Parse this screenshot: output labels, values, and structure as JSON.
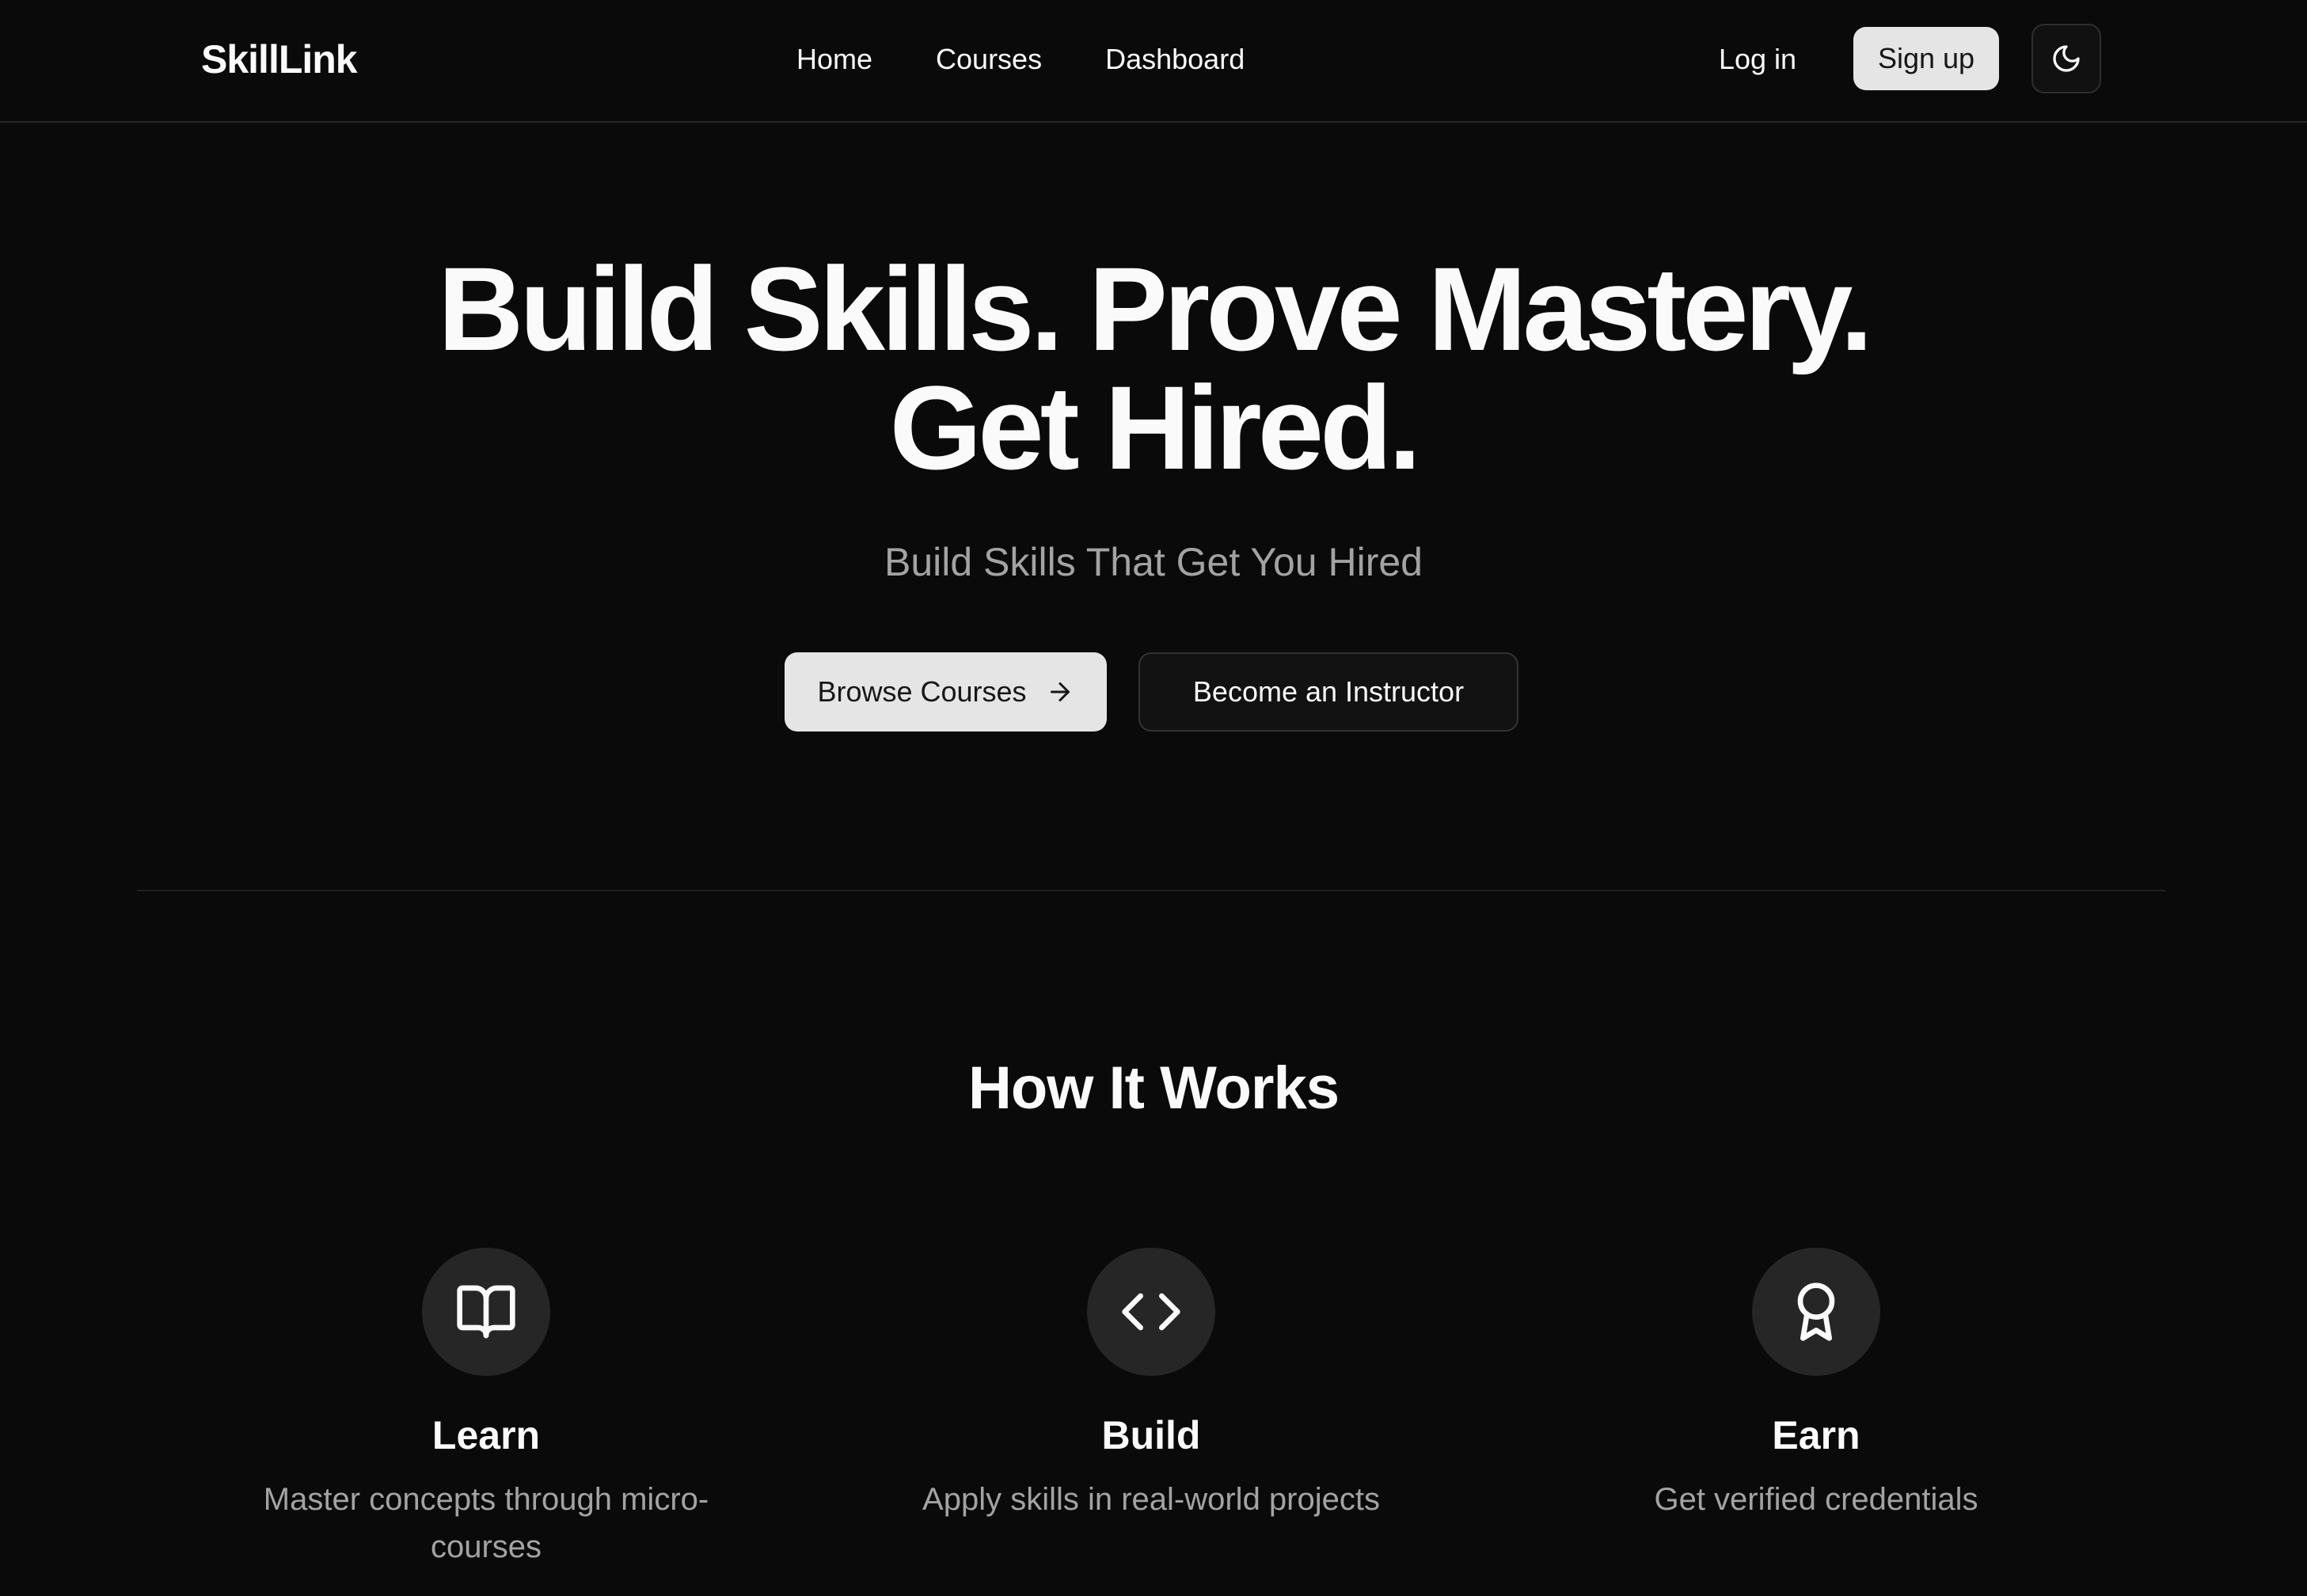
{
  "brand": {
    "name": "SkillLink"
  },
  "nav": {
    "links": [
      {
        "label": "Home"
      },
      {
        "label": "Courses"
      },
      {
        "label": "Dashboard"
      }
    ],
    "login_label": "Log in",
    "signup_label": "Sign up",
    "theme_icon": "moon-icon"
  },
  "hero": {
    "title_line1": "Build Skills. Prove Mastery.",
    "title_line2": "Get Hired.",
    "subtitle": "Build Skills That Get You Hired",
    "primary_button": "Browse Courses",
    "primary_button_icon": "arrow-right-icon",
    "secondary_button": "Become an Instructor"
  },
  "how_it_works": {
    "title": "How It Works",
    "steps": [
      {
        "icon": "book-open-icon",
        "title": "Learn",
        "description": "Master concepts through micro-courses"
      },
      {
        "icon": "code-icon",
        "title": "Build",
        "description": "Apply skills in real-world projects"
      },
      {
        "icon": "award-icon",
        "title": "Earn",
        "description": "Get verified credentials"
      }
    ]
  },
  "colors": {
    "background": "#0a0a0a",
    "foreground": "#fafafa",
    "muted_text": "#a3a3a3",
    "primary_button_bg": "#e5e5e5",
    "icon_circle_bg": "#262626"
  }
}
